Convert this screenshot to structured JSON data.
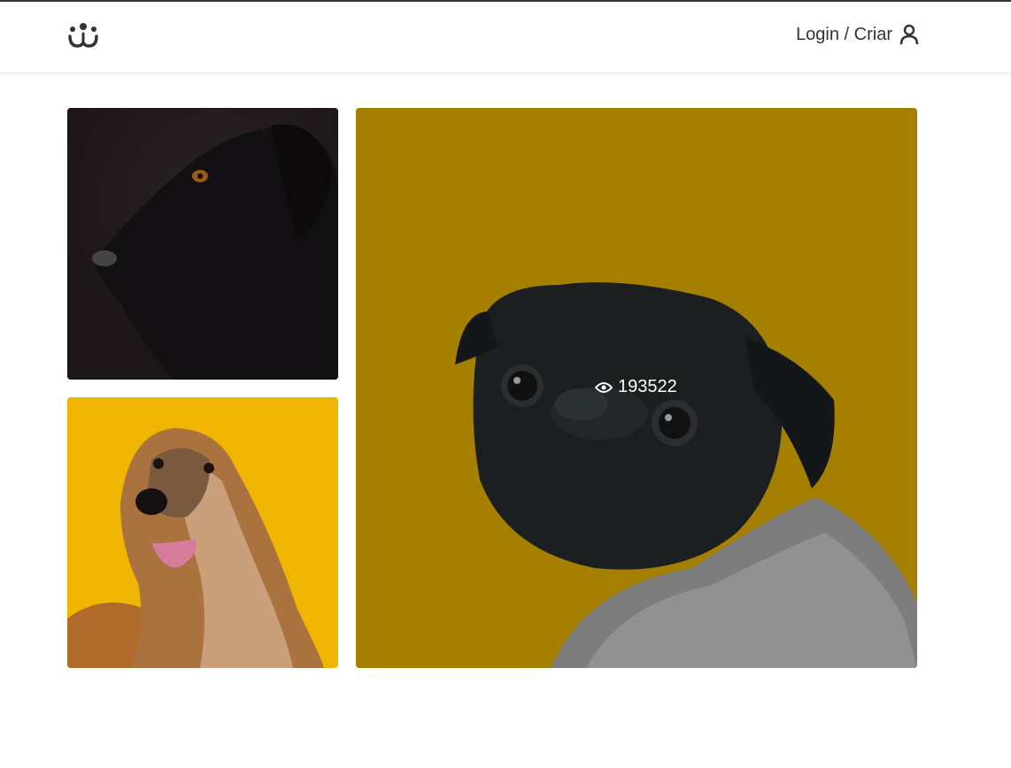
{
  "header": {
    "login_label": "Login / Criar",
    "logo_icon": "dog-face-logo-icon",
    "user_icon": "user-icon"
  },
  "feed": {
    "photos": [
      {
        "subject": "black dog profile",
        "bg_color": "#1f1719"
      },
      {
        "subject": "afghan hound",
        "bg_color": "#f0b500"
      },
      {
        "subject": "black pug in sweater",
        "bg_color": "#a57f00",
        "views": "193522",
        "view_icon": "eye-icon"
      }
    ]
  },
  "colors": {
    "text": "#333333",
    "border": "#e6e6e6",
    "topline": "#333333"
  }
}
